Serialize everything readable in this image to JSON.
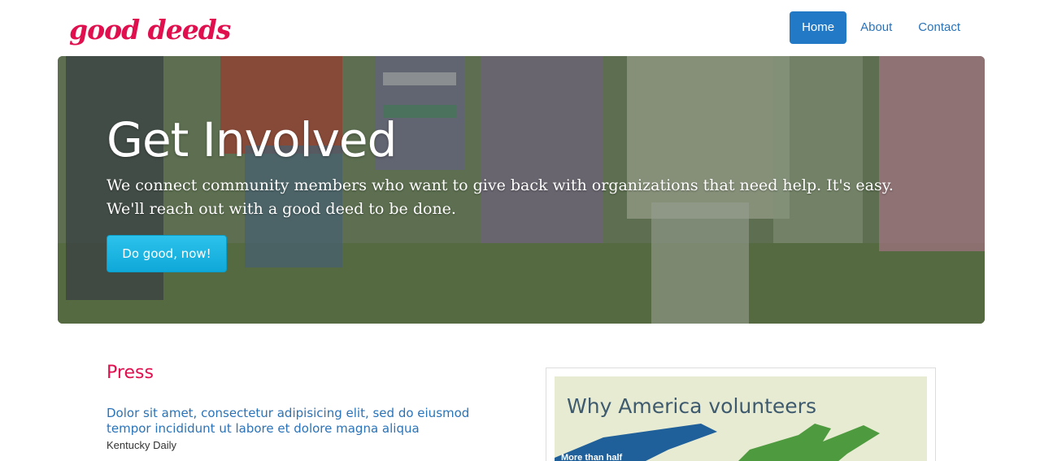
{
  "header": {
    "logo": "good deeds",
    "nav": [
      {
        "label": "Home",
        "active": true
      },
      {
        "label": "About",
        "active": false
      },
      {
        "label": "Contact",
        "active": false
      }
    ]
  },
  "hero": {
    "title": "Get Involved",
    "text": "We connect community members who want to give back with organizations that need help. It's easy. We'll reach out with a good deed to be done.",
    "button": "Do good, now!"
  },
  "press": {
    "heading": "Press",
    "items": [
      {
        "title": "Dolor sit amet, consectetur adipisicing elit, sed do eiusmod tempor incididunt ut labore et dolore magna aliqua",
        "source": "Kentucky Daily"
      }
    ]
  },
  "card": {
    "title": "Why America volunteers",
    "subtitle": "More than half"
  },
  "colors": {
    "brand": "#e0104f",
    "link": "#2a73b8",
    "nav_active": "#2279c5",
    "cta": "#1bb4e2"
  }
}
